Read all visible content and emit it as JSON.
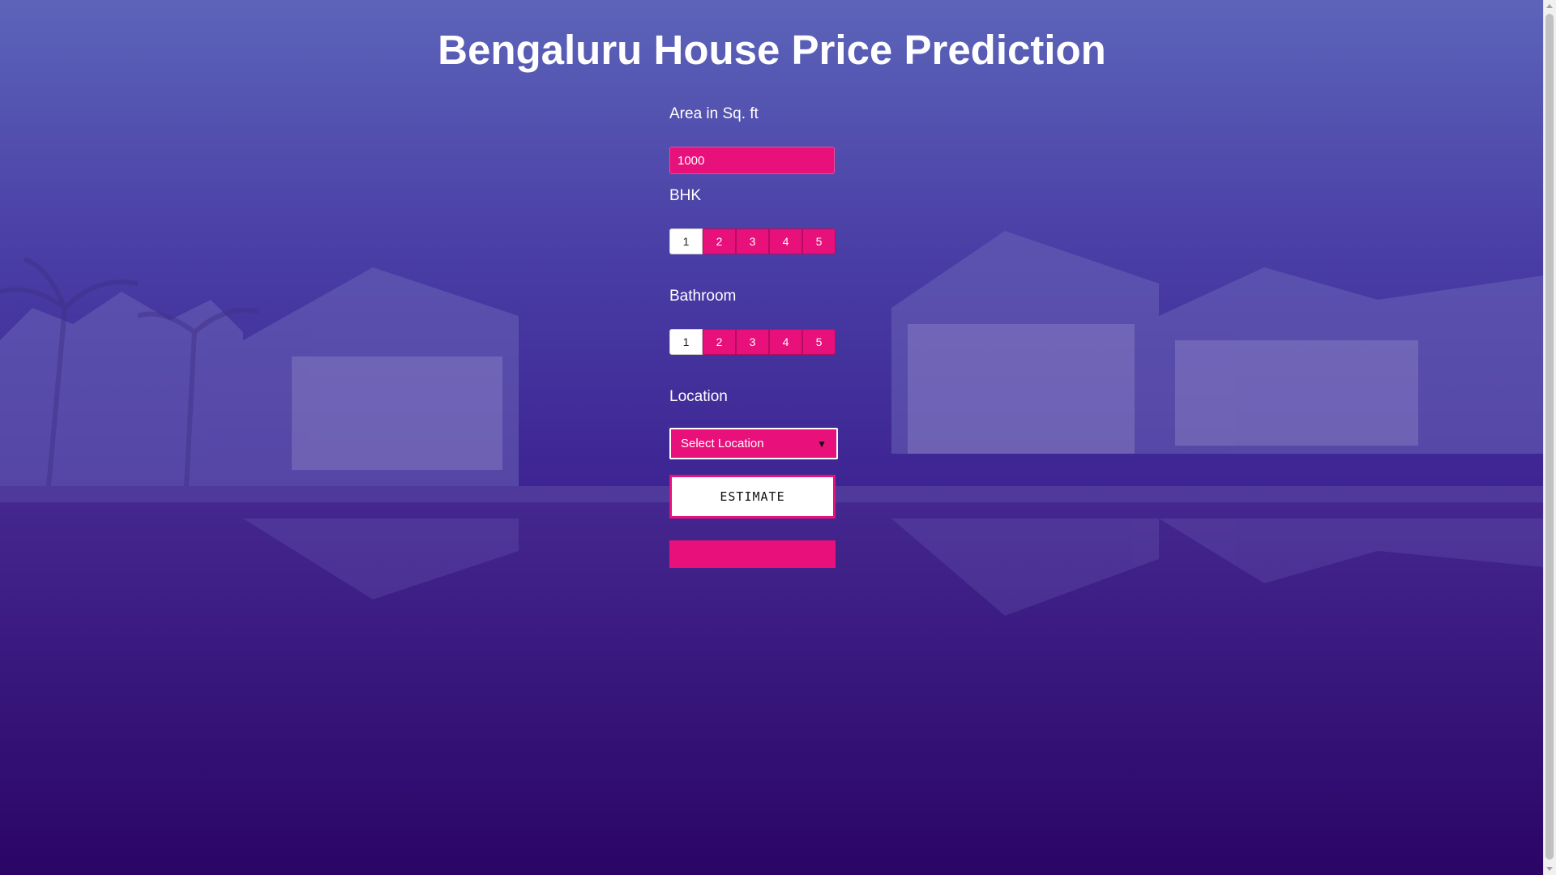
{
  "page": {
    "title": "Bengaluru House Price Prediction"
  },
  "form": {
    "area": {
      "label": "Area in Sq. ft",
      "value": "1000"
    },
    "bhk": {
      "label": "BHK",
      "options": [
        "1",
        "2",
        "3",
        "4",
        "5"
      ],
      "selected": "1"
    },
    "bathroom": {
      "label": "Bathroom",
      "options": [
        "1",
        "2",
        "3",
        "4",
        "5"
      ],
      "selected": "1"
    },
    "location": {
      "label": "Location",
      "selected": "Select Location",
      "icon": "chevron-down-icon"
    },
    "estimate_label": "ESTIMATE",
    "result": ""
  },
  "colors": {
    "accent": "#e8107a",
    "overlay_top": "#5b62b8",
    "overlay_bottom": "#2b0566",
    "text": "#ffffff"
  }
}
